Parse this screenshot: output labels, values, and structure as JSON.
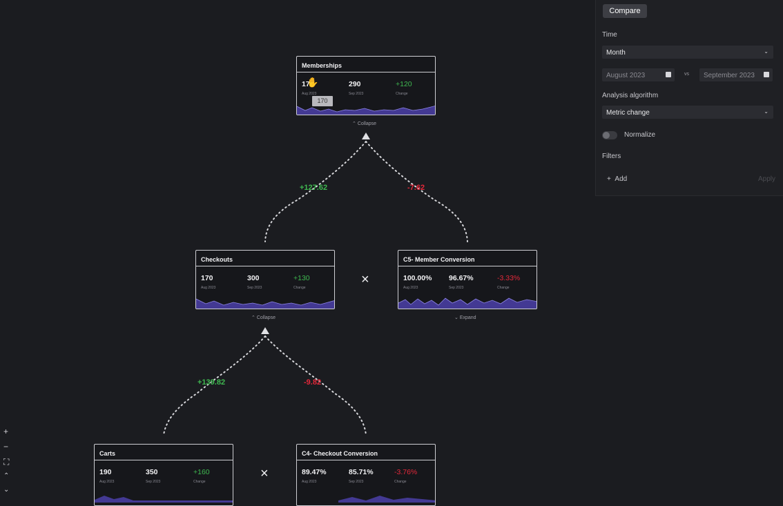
{
  "panel": {
    "compare_label": "Compare",
    "time_label": "Time",
    "time_value": "Month",
    "date_from": "August 2023",
    "vs_label": "vs",
    "date_to": "September 2023",
    "algorithm_label": "Analysis algorithm",
    "algorithm_value": "Metric change",
    "normalize_label": "Normalize",
    "filters_label": "Filters",
    "add_label": "Add",
    "apply_label": "Apply"
  },
  "nodes": {
    "memberships": {
      "title": "Memberships",
      "v1": "170",
      "v1_sub": "Aug 2023",
      "v2": "290",
      "v2_sub": "Sep 2023",
      "change": "+120",
      "change_sub": "Change",
      "toggle": "Collapse",
      "tooltip": "170"
    },
    "checkouts": {
      "title": "Checkouts",
      "v1": "170",
      "v1_sub": "Aug 2023",
      "v2": "300",
      "v2_sub": "Sep 2023",
      "change": "+130",
      "change_sub": "Change",
      "toggle": "Collapse"
    },
    "c5": {
      "title": "C5- Member Conversion",
      "v1": "100.00%",
      "v1_sub": "Aug 2023",
      "v2": "96.67%",
      "v2_sub": "Sep 2023",
      "change": "-3.33%",
      "change_sub": "Change",
      "toggle": "Expand"
    },
    "carts": {
      "title": "Carts",
      "v1": "190",
      "v1_sub": "Aug 2023",
      "v2": "350",
      "v2_sub": "Sep 2023",
      "change": "+160",
      "change_sub": "Change"
    },
    "c4": {
      "title": "C4- Checkout Conversion",
      "v1": "89.47%",
      "v1_sub": "Aug 2023",
      "v2": "85.71%",
      "v2_sub": "Sep 2023",
      "change": "-3.76%",
      "change_sub": "Change"
    }
  },
  "edges": {
    "top_left": "+127.62",
    "top_right": "-7.62",
    "mid_left": "+139.82",
    "mid_right": "-9.82"
  },
  "operators": {
    "multiply": "×"
  },
  "colors": {
    "positive": "#3fb950",
    "negative": "#e5283a",
    "spark": "#4b3fa8"
  },
  "icons": {
    "zoom_in": "zoom-in-icon",
    "zoom_out": "zoom-out-icon",
    "fit": "fit-view-icon",
    "chevron": "chevron-down-icon"
  }
}
